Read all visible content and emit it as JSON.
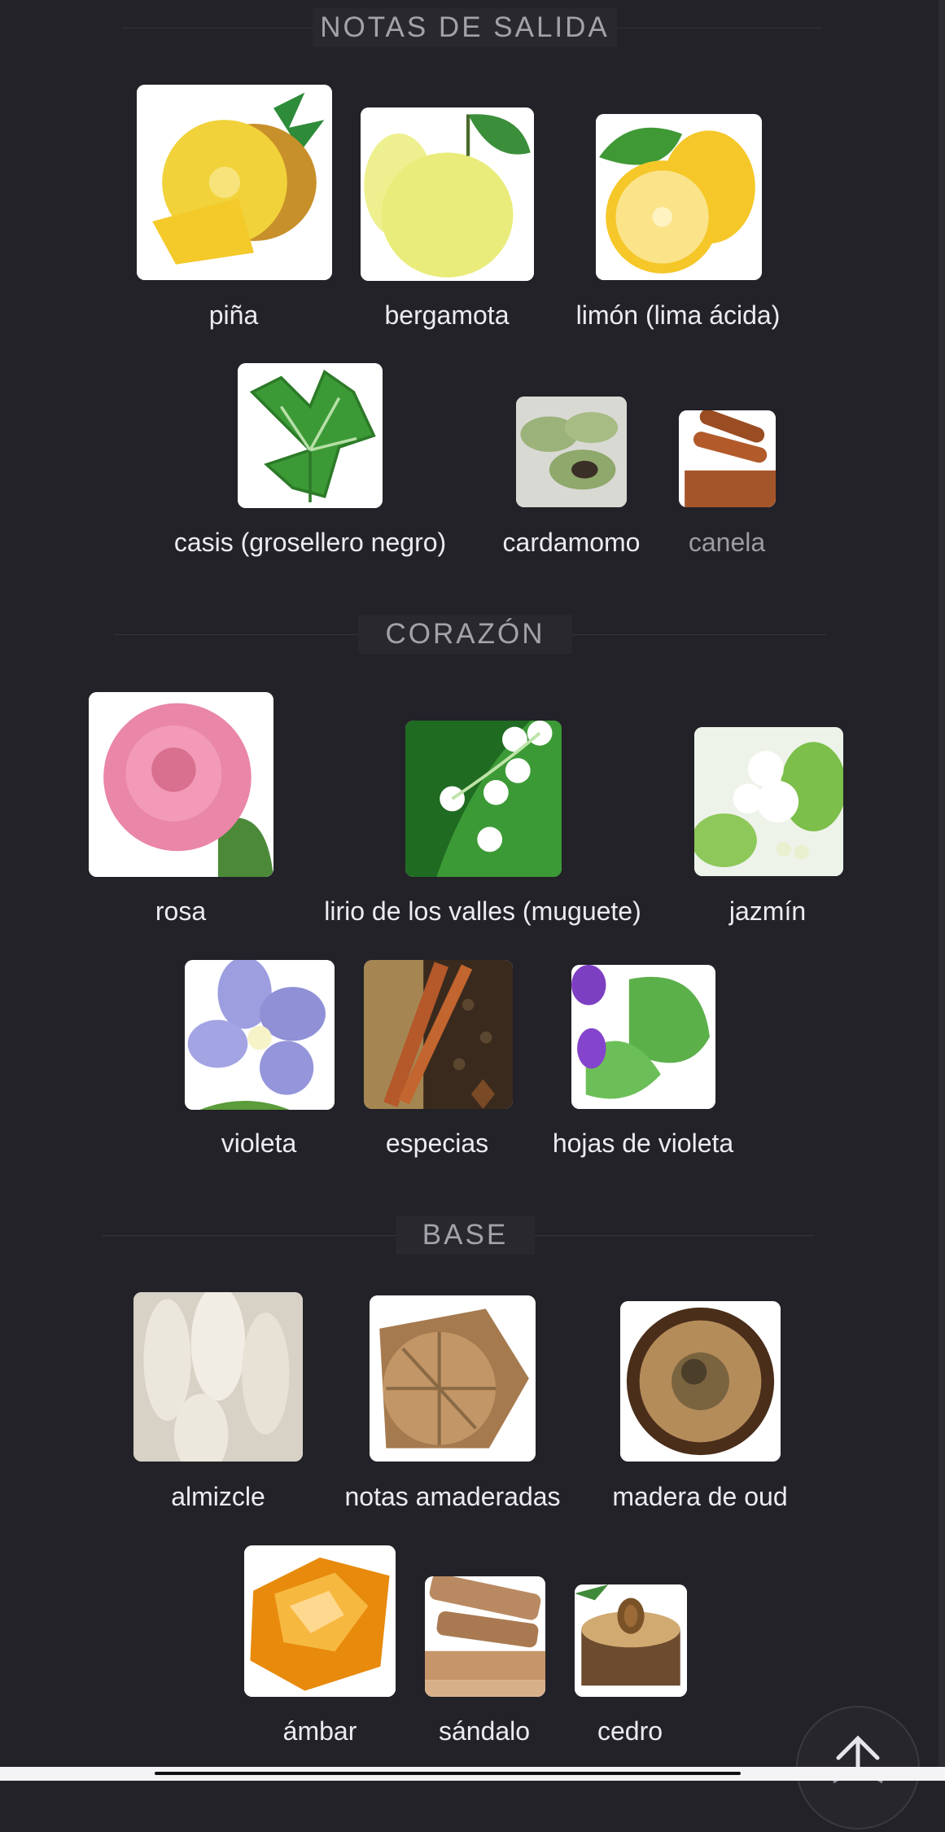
{
  "sections": [
    {
      "title": "NOTAS DE SALIDA",
      "notes": [
        {
          "name": "piña",
          "icon": "pineapple-image"
        },
        {
          "name": "bergamota",
          "icon": "bergamot-image"
        },
        {
          "name": "limón (lima ácida)",
          "icon": "lemon-image"
        },
        {
          "name": "casis (grosellero negro)",
          "icon": "blackcurrant-leaf-image"
        },
        {
          "name": "cardamomo",
          "icon": "cardamom-image"
        },
        {
          "name": "canela",
          "icon": "cinnamon-image"
        }
      ]
    },
    {
      "title": "CORAZÓN",
      "notes": [
        {
          "name": "rosa",
          "icon": "rose-image"
        },
        {
          "name": "lirio de los valles (muguete)",
          "icon": "lily-of-the-valley-image"
        },
        {
          "name": "jazmín",
          "icon": "jasmine-image"
        },
        {
          "name": "violeta",
          "icon": "violet-image"
        },
        {
          "name": "especias",
          "icon": "spices-image"
        },
        {
          "name": "hojas de violeta",
          "icon": "violet-leaves-image"
        }
      ]
    },
    {
      "title": "BASE",
      "notes": [
        {
          "name": "almizcle",
          "icon": "musk-image"
        },
        {
          "name": "notas amaderadas",
          "icon": "woody-notes-image"
        },
        {
          "name": "madera de oud",
          "icon": "oud-wood-image"
        },
        {
          "name": "ámbar",
          "icon": "amber-image"
        },
        {
          "name": "sándalo",
          "icon": "sandalwood-image"
        },
        {
          "name": "cedro",
          "icon": "cedar-image"
        }
      ]
    }
  ],
  "controls": {
    "scroll_top_icon": "arrow-up-icon"
  },
  "colors": {
    "background": "#222228",
    "section_title": "#a2a2a9",
    "note_name": "#ececf0"
  }
}
